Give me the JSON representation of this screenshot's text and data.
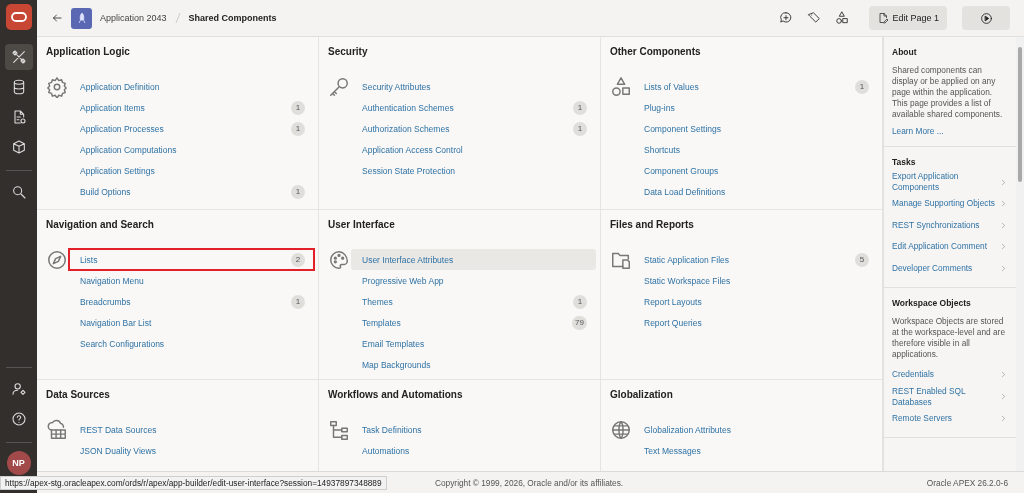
{
  "rail_items": [
    {
      "selected": true
    },
    {
      "selected": false
    },
    {
      "selected": false
    },
    {
      "selected": false
    },
    {
      "selected": false
    },
    {
      "selected": false
    },
    {
      "selected": false
    }
  ],
  "avatar": "NP",
  "header": {
    "app_name": "Application 2043",
    "page_title": "Shared Components",
    "edit_button": "Edit Page 1"
  },
  "sections": [
    {
      "title": "Application Logic",
      "items": [
        {
          "label": "Application Definition",
          "selected": false,
          "outlined": false
        },
        {
          "label": "Application Items",
          "count": "1",
          "selected": false,
          "outlined": false
        },
        {
          "label": "Application Processes",
          "count": "1",
          "selected": false,
          "outlined": false
        },
        {
          "label": "Application Computations",
          "selected": false,
          "outlined": false
        },
        {
          "label": "Application Settings",
          "selected": false,
          "outlined": false
        },
        {
          "label": "Build Options",
          "count": "1",
          "selected": false,
          "outlined": false
        }
      ]
    },
    {
      "title": "Security",
      "items": [
        {
          "label": "Security Attributes",
          "selected": false,
          "outlined": false
        },
        {
          "label": "Authentication Schemes",
          "count": "1",
          "selected": false,
          "outlined": false
        },
        {
          "label": "Authorization Schemes",
          "count": "1",
          "selected": false,
          "outlined": false
        },
        {
          "label": "Application Access Control",
          "selected": false,
          "outlined": false
        },
        {
          "label": "Session State Protection",
          "selected": false,
          "outlined": false
        }
      ]
    },
    {
      "title": "Other Components",
      "items": [
        {
          "label": "Lists of Values",
          "count": "1",
          "selected": false,
          "outlined": false
        },
        {
          "label": "Plug-ins",
          "selected": false,
          "outlined": false
        },
        {
          "label": "Component Settings",
          "selected": false,
          "outlined": false
        },
        {
          "label": "Shortcuts",
          "selected": false,
          "outlined": false
        },
        {
          "label": "Component Groups",
          "selected": false,
          "outlined": false
        },
        {
          "label": "Data Load Definitions",
          "selected": false,
          "outlined": false
        }
      ]
    },
    {
      "title": "Navigation and Search",
      "items": [
        {
          "label": "Lists",
          "count": "2",
          "selected": false,
          "outlined": true
        },
        {
          "label": "Navigation Menu",
          "selected": false,
          "outlined": false
        },
        {
          "label": "Breadcrumbs",
          "count": "1",
          "selected": false,
          "outlined": false
        },
        {
          "label": "Navigation Bar List",
          "selected": false,
          "outlined": false
        },
        {
          "label": "Search Configurations",
          "selected": false,
          "outlined": false
        }
      ]
    },
    {
      "title": "User Interface",
      "items": [
        {
          "label": "User Interface Attributes",
          "selected": true,
          "outlined": false
        },
        {
          "label": "Progressive Web App",
          "selected": false,
          "outlined": false
        },
        {
          "label": "Themes",
          "count": "1",
          "selected": false,
          "outlined": false
        },
        {
          "label": "Templates",
          "count": "79",
          "selected": false,
          "outlined": false
        },
        {
          "label": "Email Templates",
          "selected": false,
          "outlined": false
        },
        {
          "label": "Map Backgrounds",
          "selected": false,
          "outlined": false
        }
      ]
    },
    {
      "title": "Files and Reports",
      "items": [
        {
          "label": "Static Application Files",
          "count": "5",
          "selected": false,
          "outlined": false
        },
        {
          "label": "Static Workspace Files",
          "selected": false,
          "outlined": false
        },
        {
          "label": "Report Layouts",
          "selected": false,
          "outlined": false
        },
        {
          "label": "Report Queries",
          "selected": false,
          "outlined": false
        }
      ]
    },
    {
      "title": "Data Sources",
      "items": [
        {
          "label": "REST Data Sources",
          "selected": false,
          "outlined": false
        },
        {
          "label": "JSON Duality Views",
          "selected": false,
          "outlined": false
        }
      ]
    },
    {
      "title": "Workflows and Automations",
      "items": [
        {
          "label": "Task Definitions",
          "selected": false,
          "outlined": false
        },
        {
          "label": "Automations",
          "selected": false,
          "outlined": false
        }
      ]
    },
    {
      "title": "Globalization",
      "items": [
        {
          "label": "Globalization Attributes",
          "selected": false,
          "outlined": false
        },
        {
          "label": "Text Messages",
          "selected": false,
          "outlined": false
        }
      ]
    }
  ],
  "side_panel": {
    "about": {
      "title": "About",
      "text": "Shared components can display or be applied on any page within the application. This page provides a list of available shared components.",
      "link": "Learn More ..."
    },
    "tasks": {
      "title": "Tasks",
      "items": [
        "Export Application Components",
        "Manage Supporting Objects",
        "REST Synchronizations",
        "Edit Application Comment",
        "Developer Comments"
      ]
    },
    "workspace": {
      "title": "Workspace Objects",
      "text": "Workspace Objects are stored at the workspace-level and are therefore visible in all applications.",
      "items": [
        "Credentials",
        "REST Enabled SQL Databases",
        "Remote Servers"
      ]
    }
  },
  "footer": {
    "copyright": "Copyright © 1999, 2026, Oracle and/or its affiliates.",
    "version": "Oracle APEX 26.2.0-6"
  },
  "status_url": "https://apex-stg.oracleapex.com/ords/r/apex/app-builder/edit-user-interface?session=14937897348889"
}
